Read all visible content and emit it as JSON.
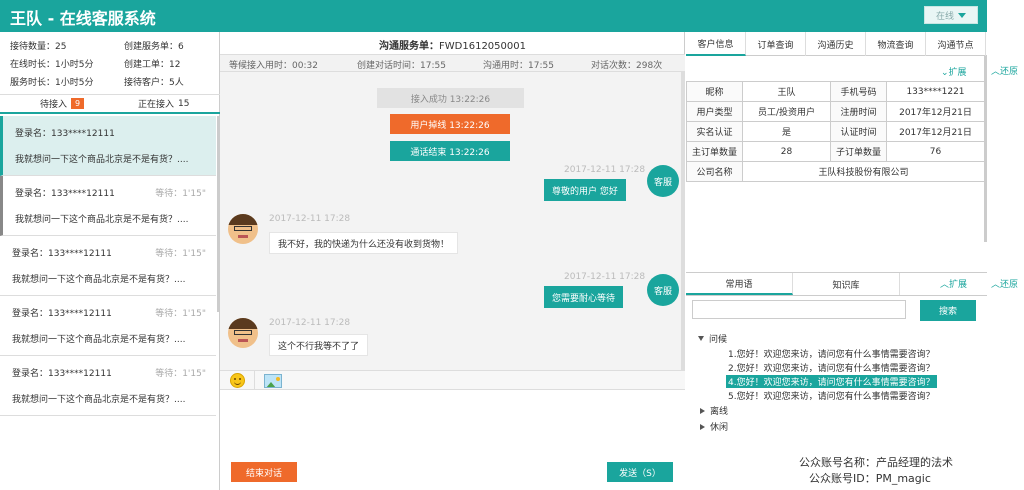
{
  "app": {
    "title": "王队 - 在线客服系统",
    "status": "在线"
  },
  "stats": [
    {
      "label": "接待数量：25"
    },
    {
      "label": "创建服务单：6"
    },
    {
      "label": "在线时长：1小时5分"
    },
    {
      "label": "创建工单：12"
    },
    {
      "label": "服务时长：1小时5分"
    },
    {
      "label": "接待客户：5人"
    }
  ],
  "queue_tabs": {
    "waiting_label": "待接入",
    "waiting_count": "9",
    "serving_label": "正在接入",
    "serving_count": "15"
  },
  "queue": [
    {
      "name": "登录名：133****12111",
      "wait": "",
      "msg": "我就想问一下这个商品北京是不是有货？...."
    },
    {
      "name": "登录名：133****12111",
      "wait": "等待：1'15\"",
      "msg": "我就想问一下这个商品北京是不是有货？...."
    },
    {
      "name": "登录名：133****12111",
      "wait": "等待：1'15\"",
      "msg": "我就想问一下这个商品北京是不是有货？...."
    },
    {
      "name": "登录名：133****12111",
      "wait": "等待：1'15\"",
      "msg": "我就想问一下这个商品北京是不是有货？...."
    },
    {
      "name": "登录名：133****12111",
      "wait": "等待：1'15\"",
      "msg": "我就想问一下这个商品北京是不是有货？...."
    }
  ],
  "chat": {
    "service_label": "沟通服务单：",
    "service_no": "FWD1612050001",
    "meta": [
      "等候接入用时：00:32",
      "创建对话时间：17:55",
      "沟通用时：17:55",
      "对话次数：298次"
    ],
    "sys": [
      "接入成功 13:22:26",
      "用户掉线 13:22:26",
      "通话结束 13:22:26"
    ],
    "agent_label": "客服",
    "messages": [
      {
        "time": "2017-12-11 17:28",
        "text": "尊敬的用户 您好"
      },
      {
        "time": "2017-12-11 17:28",
        "text": "我不好，我的快递为什么还没有收到货物！"
      },
      {
        "time": "2017-12-11 17:28",
        "text": "您需要耐心等待"
      },
      {
        "time": "2017-12-11 17:28",
        "text": "这个不行我等不了了"
      }
    ],
    "end_button": "结束对话",
    "send_button": "发送（S）"
  },
  "right_tabs": [
    "客户信息",
    "订单查询",
    "沟通历史",
    "物流查询",
    "沟通节点"
  ],
  "expand_label": "扩展",
  "restore_label": "还原",
  "customer": {
    "rows": [
      [
        "昵称",
        "王队",
        "手机号码",
        "133****1221"
      ],
      [
        "用户类型",
        "员工/投资用户",
        "注册时间",
        "2017年12月21日"
      ],
      [
        "实名认证",
        "是",
        "认证时间",
        "2017年12月21日"
      ],
      [
        "主订单数量",
        "28",
        "子订单数量",
        "76"
      ]
    ],
    "company_label": "公司名称",
    "company_value": "王队科技股份有限公司"
  },
  "bottom_tabs": [
    "常用语",
    "知识库"
  ],
  "search": {
    "placeholder": "",
    "button": "搜索"
  },
  "tree": {
    "greeting": "问候",
    "items": [
      "1.您好！欢迎您来访，请问您有什么事情需要咨询？",
      "2.您好！欢迎您来访，请问您有什么事情需要咨询？",
      "4.您好！欢迎您来访，请问您有什么事情需要咨询？",
      "5.您好！欢迎您来访，请问您有什么事情需要咨询？"
    ],
    "offline": "离线",
    "idle": "休闲"
  },
  "watermark": {
    "line1": "公众账号名称：产品经理的法术",
    "line2": "公众账号ID：PM_magic"
  },
  "colors": {
    "accent": "#1aa59d",
    "warn": "#ef6a2b"
  }
}
